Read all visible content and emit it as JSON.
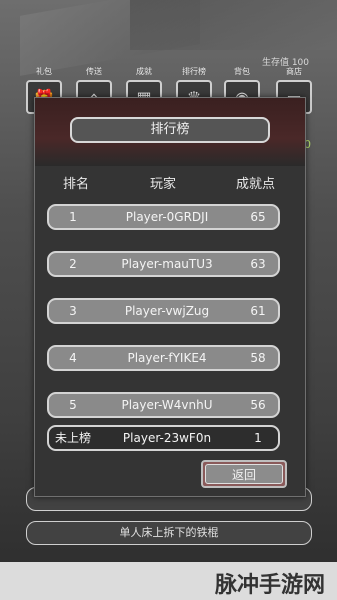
{
  "hud": {
    "survival": "生存值 100",
    "tabs": [
      {
        "label": "礼包",
        "icon": "gift-icon",
        "glyph": "🎁"
      },
      {
        "label": "传送",
        "icon": "portal-icon",
        "glyph": "⌂"
      },
      {
        "label": "成就",
        "icon": "achievement-icon",
        "glyph": "▦"
      },
      {
        "label": "排行榜",
        "icon": "ranking-icon",
        "glyph": "♛"
      },
      {
        "label": "背包",
        "icon": "bag-icon",
        "glyph": "◉"
      },
      {
        "label": "商店",
        "icon": "shop-icon",
        "glyph": "▭"
      }
    ],
    "side_value": "0",
    "bottom_hint": "单人床上拆下的铁棍"
  },
  "leaderboard": {
    "title": "排行榜",
    "headers": {
      "rank": "排名",
      "player": "玩家",
      "score": "成就点"
    },
    "rows": [
      {
        "rank": "1",
        "player": "Player-0GRDJI",
        "score": "65"
      },
      {
        "rank": "2",
        "player": "Player-mauTU3",
        "score": "63"
      },
      {
        "rank": "3",
        "player": "Player-vwjZug",
        "score": "61"
      },
      {
        "rank": "4",
        "player": "Player-fYIKE4",
        "score": "58"
      },
      {
        "rank": "5",
        "player": "Player-W4vnhU",
        "score": "56"
      }
    ],
    "mine": {
      "rank": "未上榜",
      "player": "Player-23wF0n",
      "score": "1"
    },
    "back_label": "返回"
  },
  "watermark": "脉冲手游网"
}
